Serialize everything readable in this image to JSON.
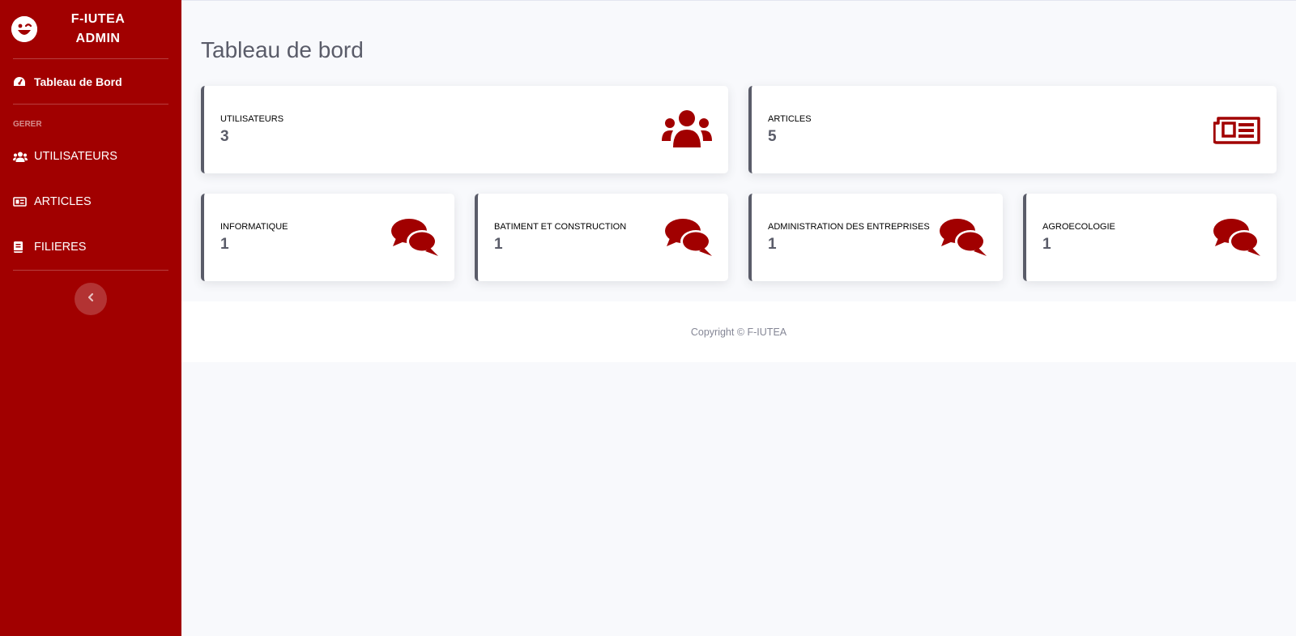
{
  "brand": {
    "line1": "F-IUTEA",
    "line2": "ADMIN",
    "icon": "laugh-wink-icon"
  },
  "sidebar": {
    "dashboard_label": "Tableau de Bord",
    "section_heading": "GERER",
    "items": [
      {
        "label": "UTILISATEURS",
        "icon": "users-icon"
      },
      {
        "label": "ARTICLES",
        "icon": "newspaper-icon"
      },
      {
        "label": "FILIERES",
        "icon": "book-icon"
      }
    ],
    "toggle_icon": "chevron-left-icon"
  },
  "main": {
    "title": "Tableau de bord"
  },
  "cards_top": [
    {
      "label": "UTILISATEURS",
      "value": "3",
      "icon": "users-icon"
    },
    {
      "label": "ARTICLES",
      "value": "5",
      "icon": "newspaper-icon"
    }
  ],
  "cards_filieres": [
    {
      "label": "INFORMATIQUE",
      "value": "1",
      "icon": "comments-icon"
    },
    {
      "label": "BATIMENT ET CONSTRUCTION",
      "value": "1",
      "icon": "comments-icon"
    },
    {
      "label": "ADMINISTRATION DES ENTREPRISES",
      "value": "1",
      "icon": "comments-icon"
    },
    {
      "label": "AGROECOLOGIE",
      "value": "1",
      "icon": "comments-icon"
    }
  ],
  "footer": {
    "copyright": "Copyright © F-IUTEA"
  },
  "colors": {
    "accent": "#a10000",
    "text_gray": "#5a5c69",
    "background": "#f8f9fc"
  }
}
